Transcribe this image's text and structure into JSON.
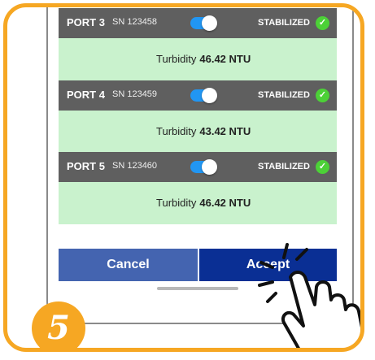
{
  "ports": [
    {
      "label": "PORT 3",
      "sn": "SN 123458",
      "status": "STABILIZED",
      "reading_label": "Turbidity",
      "reading_value": "46.42 NTU"
    },
    {
      "label": "PORT 4",
      "sn": "SN 123459",
      "status": "STABILIZED",
      "reading_label": "Turbidity",
      "reading_value": "43.42 NTU"
    },
    {
      "label": "PORT 5",
      "sn": "SN 123460",
      "status": "STABILIZED",
      "reading_label": "Turbidity",
      "reading_value": "46.42 NTU"
    }
  ],
  "buttons": {
    "cancel": "Cancel",
    "accept": "Accept"
  },
  "step": "5",
  "colors": {
    "frame": "#f6a723",
    "header": "#5f5f5f",
    "reading_bg": "#c9f2cd",
    "toggle": "#2196f3",
    "check": "#4cd137",
    "cancel": "#4464b0",
    "accept": "#0a2f94"
  }
}
